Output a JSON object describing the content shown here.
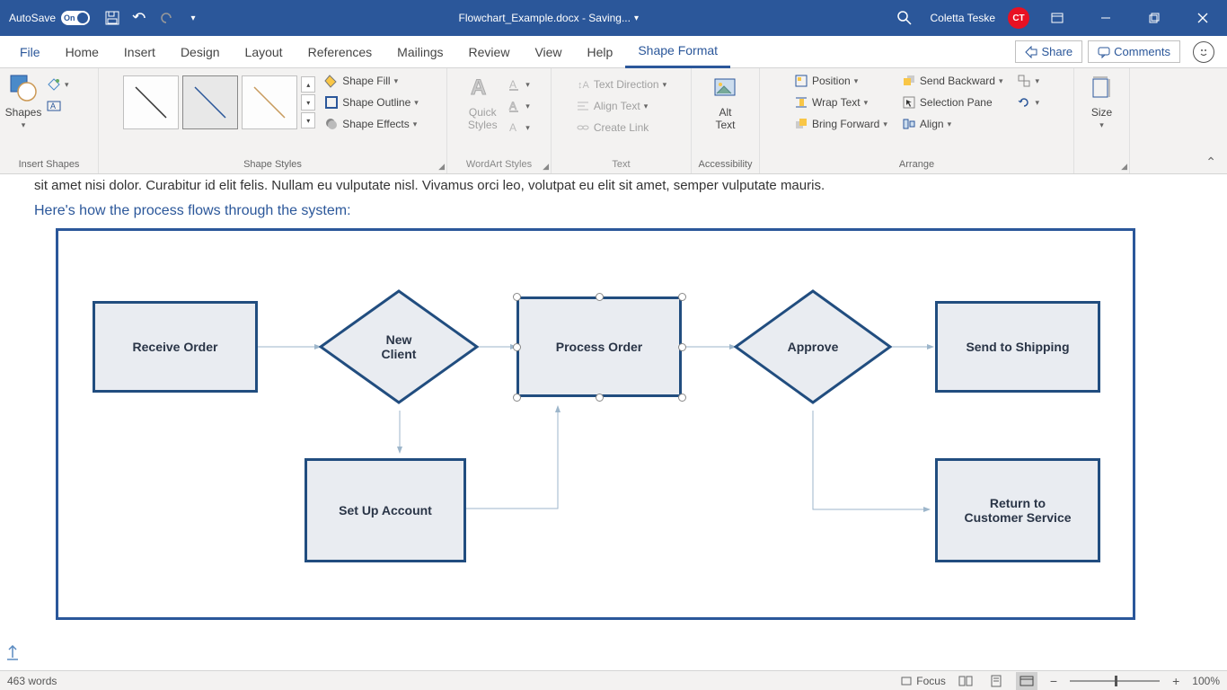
{
  "titleBar": {
    "autosave": "AutoSave",
    "autosaveState": "On",
    "docTitle": "Flowchart_Example.docx - Saving...",
    "userName": "Coletta Teske",
    "userInitials": "CT"
  },
  "tabs": {
    "file": "File",
    "home": "Home",
    "insert": "Insert",
    "design": "Design",
    "layout": "Layout",
    "references": "References",
    "mailings": "Mailings",
    "review": "Review",
    "view": "View",
    "help": "Help",
    "shapeFormat": "Shape Format",
    "share": "Share",
    "comments": "Comments"
  },
  "ribbon": {
    "insertShapes": {
      "shapes": "Shapes",
      "label": "Insert Shapes"
    },
    "shapeStyles": {
      "fill": "Shape Fill",
      "outline": "Shape Outline",
      "effects": "Shape Effects",
      "label": "Shape Styles"
    },
    "wordart": {
      "quick": "Quick\nStyles",
      "label": "WordArt Styles"
    },
    "text": {
      "direction": "Text Direction",
      "align": "Align Text",
      "link": "Create Link",
      "label": "Text"
    },
    "accessibility": {
      "alt": "Alt\nText",
      "label": "Accessibility"
    },
    "arrange": {
      "position": "Position",
      "wrap": "Wrap Text",
      "forward": "Bring Forward",
      "backward": "Send Backward",
      "selection": "Selection Pane",
      "align": "Align",
      "label": "Arrange"
    },
    "size": {
      "size": "Size"
    }
  },
  "document": {
    "bodyClip": "sit amet nisi dolor. Curabitur id elit felis. Nullam eu vulputate nisl. Vivamus orci leo, volutpat eu elit sit amet, semper vulputate mauris.",
    "heading": "Here's how the process flows through the system:",
    "nodes": {
      "receive": "Receive Order",
      "newClient": "New\nClient",
      "process": "Process Order",
      "approve": "Approve",
      "ship": "Send to Shipping",
      "setup": "Set Up Account",
      "return": "Return to\nCustomer Service"
    }
  },
  "status": {
    "words": "463 words",
    "focus": "Focus",
    "zoom": "100%"
  }
}
